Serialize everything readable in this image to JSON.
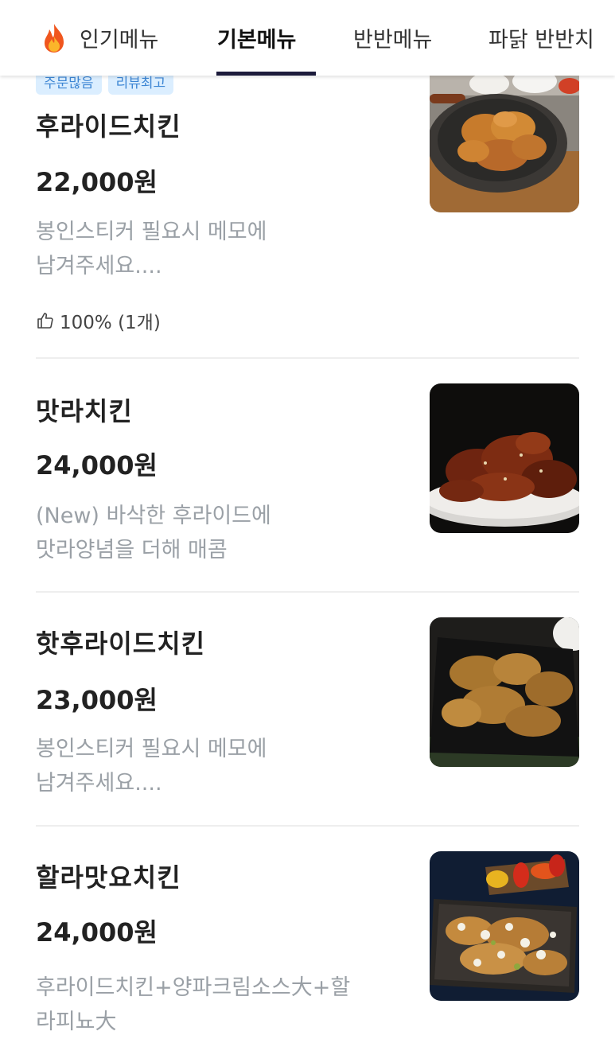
{
  "tabs": [
    {
      "label": "인기메뉴",
      "icon": "flame-icon",
      "active": false
    },
    {
      "label": "기본메뉴",
      "active": true
    },
    {
      "label": "반반메뉴",
      "active": false
    },
    {
      "label": "파닭 반반치",
      "active": false
    }
  ],
  "items": [
    {
      "tags": [
        "주문많음",
        "리뷰최고"
      ],
      "name": "후라이드치킨",
      "price": "22,000원",
      "desc_lines": [
        "봉인스티커 필요시 메모에",
        "남겨주세요...."
      ],
      "review": "100% (1개)"
    },
    {
      "name": "맛라치킨",
      "price": "24,000원",
      "desc_lines": [
        "(New) 바삭한 후라이드에",
        "맛라양념을 더해 매콤"
      ]
    },
    {
      "name": "핫후라이드치킨",
      "price": "23,000원",
      "desc_lines": [
        "봉인스티커 필요시 메모에",
        "남겨주세요...."
      ]
    },
    {
      "name": "할라맛요치킨",
      "price": "24,000원",
      "desc_lines": [
        "후라이드치킨+양파크림소스大+할",
        "라피뇨大"
      ]
    }
  ],
  "colors": {
    "accent_underline": "#1b1a3a",
    "tag_bg": "#dbeeff",
    "tag_text": "#3d86d4",
    "desc_text": "#9aa0a6"
  }
}
